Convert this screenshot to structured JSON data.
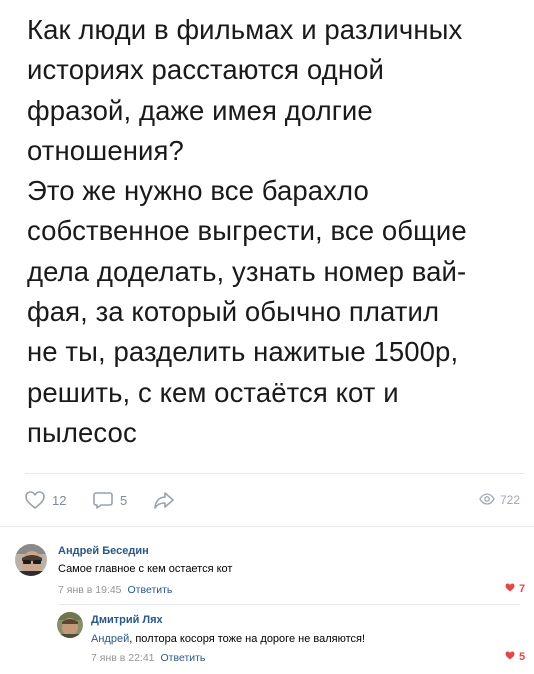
{
  "post": {
    "text_p1": "Как люди в фильмах и различных\nисториях расстаются одной\nфразой, даже имея долгие\nотношения?",
    "text_p2": "Это же нужно все барахло\nсобственное выгрести, все общие\nдела доделать, узнать номер вай-\nфая, за который обычно платил\nне ты, разделить нажитые 1500р,\nрешить, с кем остаётся кот и\nпылесос"
  },
  "actions": {
    "likes": "12",
    "comments": "5",
    "views": "722",
    "like_icon": "heart-outline-icon",
    "comment_icon": "comment-bubble-icon",
    "share_icon": "share-arrow-icon",
    "views_icon": "eye-icon"
  },
  "comments": [
    {
      "author": "Андрей Беседин",
      "text": "Самое главное с кем остается кот",
      "date": "7 янв в 19:45",
      "reply_label": "Ответить",
      "likes": "7"
    },
    {
      "author": "Дмитрий Лях",
      "mention": "Андрей",
      "text": ", полтора косоря тоже на дороге не валяются!",
      "date": "7 янв в 22:41",
      "reply_label": "Ответить",
      "likes": "5"
    }
  ],
  "colors": {
    "link": "#2a5885",
    "like_red": "#e64646",
    "muted": "#939393",
    "divider": "#e7e8ec"
  }
}
